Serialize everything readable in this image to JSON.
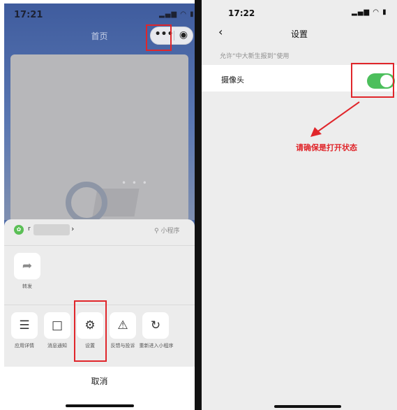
{
  "left": {
    "status_time": "17:21",
    "status_icons": "▂▄▆ ◠ ▮",
    "nav_title": "首页",
    "capsule": {
      "more": "•••",
      "close": "◉"
    },
    "app_row": {
      "name": "r",
      "chevron": "›",
      "mini_label": "⚲ 小程序"
    },
    "share": {
      "label": "转发",
      "icon": "➦"
    },
    "actions": [
      {
        "label": "应用详情",
        "icon": "☰"
      },
      {
        "label": "消息通知",
        "icon": "□"
      },
      {
        "label": "设置",
        "icon": "⚙"
      },
      {
        "label": "反馈与投诉",
        "icon": "⚠"
      },
      {
        "label": "重新进入小程序",
        "icon": "↻"
      }
    ],
    "cancel": "取消"
  },
  "right": {
    "status_time": "17:22",
    "status_icons": "▂▄▆ ◠ ▮",
    "back_icon": "‹",
    "title": "设置",
    "allow_text": "允许“中大新生报到”使用",
    "camera_label": "摄像头",
    "toggle_on": true,
    "note": "请确保是打开状态"
  },
  "colors": {
    "highlight": "#e0262b",
    "toggle_green": "#4cbf5c"
  }
}
